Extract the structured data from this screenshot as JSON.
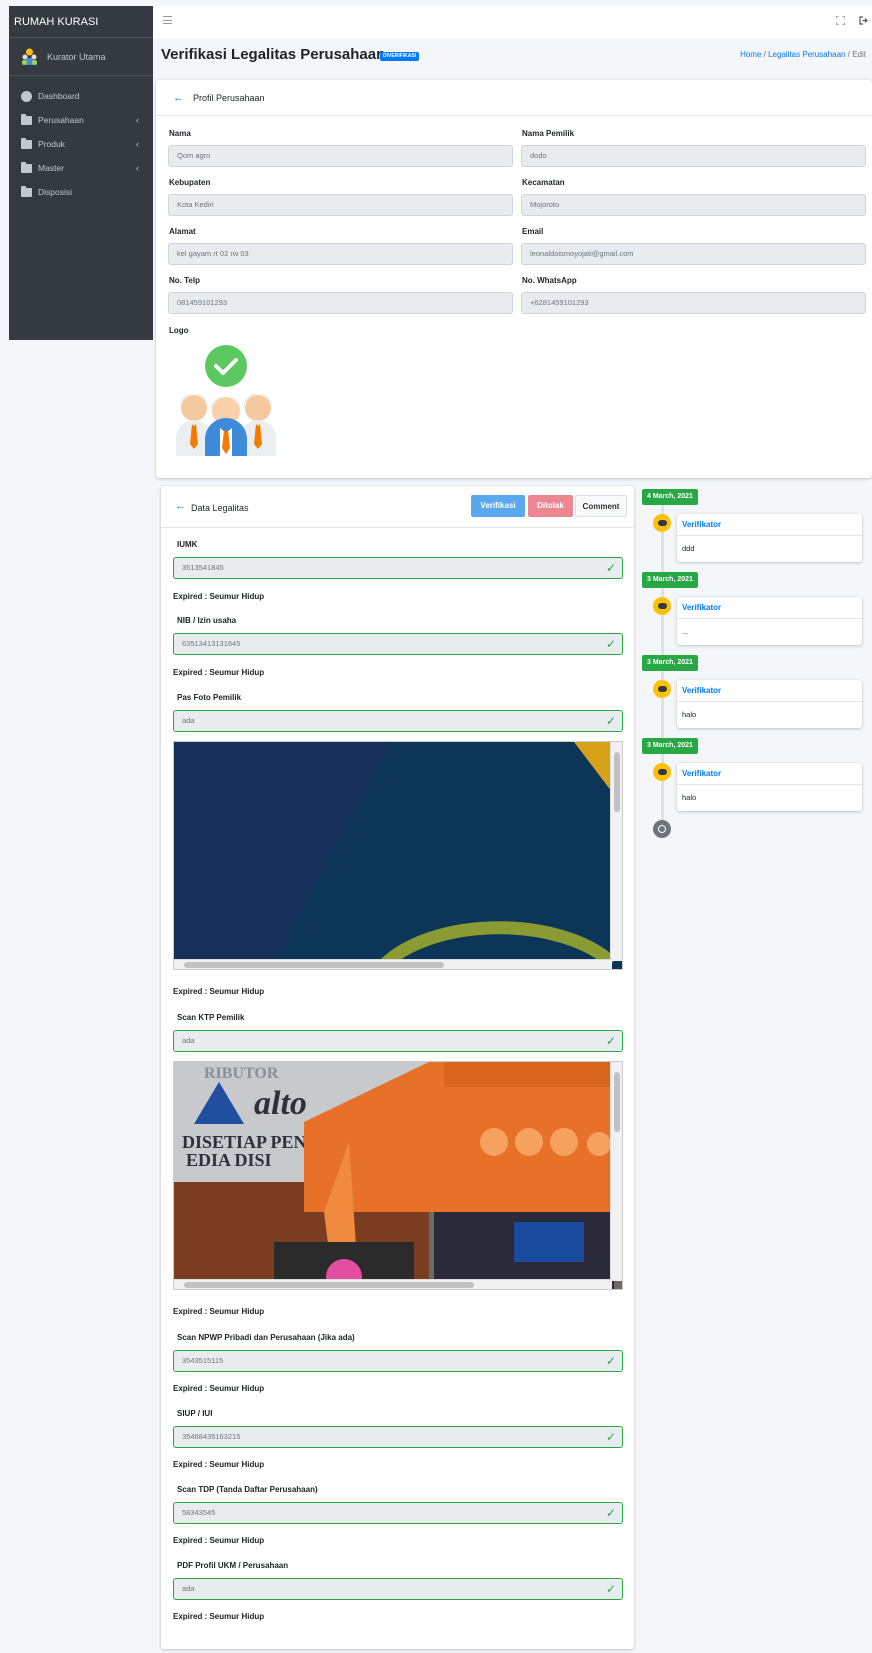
{
  "brand": "RUMAH KURASI",
  "user": {
    "name": "Kurator Utama"
  },
  "menu": [
    {
      "label": "Dashboard",
      "icon": "dashboard-icon",
      "has_caret": false
    },
    {
      "label": "Perusahaan",
      "icon": "folder-icon",
      "has_caret": true
    },
    {
      "label": "Produk",
      "icon": "folder-icon",
      "has_caret": true
    },
    {
      "label": "Master",
      "icon": "folder-icon",
      "has_caret": true
    },
    {
      "label": "Disposisi",
      "icon": "folder-icon",
      "has_caret": false
    }
  ],
  "header": {
    "title": "Verifikasi Legalitas Perusahaan",
    "badge": "DIVERIFIKASI",
    "breadcrumb": {
      "home": "Home",
      "sep1": "/",
      "section": "Legalitas Perusahaan",
      "sep2": "/",
      "current": "Edit"
    }
  },
  "profile": {
    "header": "Profil Perusahaan",
    "fields": {
      "nama": {
        "label": "Nama",
        "value": "Qom agro"
      },
      "nama_pemilik": {
        "label": "Nama Pemilik",
        "value": "dodo"
      },
      "kabupaten": {
        "label": "Kebupaten",
        "value": "Kota Kediri"
      },
      "kecamatan": {
        "label": "Kecamatan",
        "value": "Mojoroto"
      },
      "alamat": {
        "label": "Alamat",
        "value": "kel gayam rt 02 rw 03"
      },
      "email": {
        "label": "Email",
        "value": "leonaldoismoyojati@gmail.com"
      },
      "telp": {
        "label": "No. Telp",
        "value": "081459101293"
      },
      "whatsapp": {
        "label": "No. WhatsApp",
        "value": "+6281459101293"
      }
    },
    "logo_label": "Logo"
  },
  "legal": {
    "header": "Data Legalitas",
    "buttons": {
      "verifikasi": "Verifikasi",
      "ditolak": "Ditolak",
      "comment": "Comment"
    },
    "items": [
      {
        "label": "IUMK",
        "value": "3513541845",
        "expired": "Expired : Seumur Hidup"
      },
      {
        "label": "NIB / Izin usaha",
        "value": "63513413131645",
        "expired": "Expired : Seumur Hidup"
      },
      {
        "label": "Pas Foto Pemilik",
        "value": "ada",
        "expired": "Expired : Seumur Hidup"
      },
      {
        "label": "Scan KTP Pemilik",
        "value": "ada",
        "expired": "Expired : Seumur Hidup"
      },
      {
        "label": "Scan NPWP Pribadi dan Perusahaan (Jika ada)",
        "value": "3543515115",
        "expired": "Expired : Seumur Hidup"
      },
      {
        "label": "SIUP / IUI",
        "value": "35468435163215",
        "expired": "Expired : Seumur Hidup"
      },
      {
        "label": "Scan TDP (Tanda Daftar Perusahaan)",
        "value": "58343545",
        "expired": "Expired : Seumur Hidup"
      },
      {
        "label": "PDF Profil UKM / Perusahaan",
        "value": "ada",
        "expired": "Expired : Seumur Hidup"
      }
    ],
    "ktp_photo_texts": {
      "banner_brand": "alto",
      "banner_line1": "DISETIAP PENA",
      "banner_line2": "EDIA DISI",
      "top_text": "RIBUTOR"
    }
  },
  "timeline": [
    {
      "date": "4 March, 2021",
      "author": "Verifikator",
      "comment": "ddd"
    },
    {
      "date": "3 March, 2021",
      "author": "Verifikator",
      "comment": "..."
    },
    {
      "date": "3 March, 2021",
      "author": "Verifikator",
      "comment": "halo"
    },
    {
      "date": "3 March, 2021",
      "author": "Verifikator",
      "comment": "halo"
    }
  ],
  "colors": {
    "sidebar": "#343a40",
    "primary": "#007bff",
    "success": "#28a745",
    "warning": "#ffc107",
    "danger": "#ec8792"
  }
}
